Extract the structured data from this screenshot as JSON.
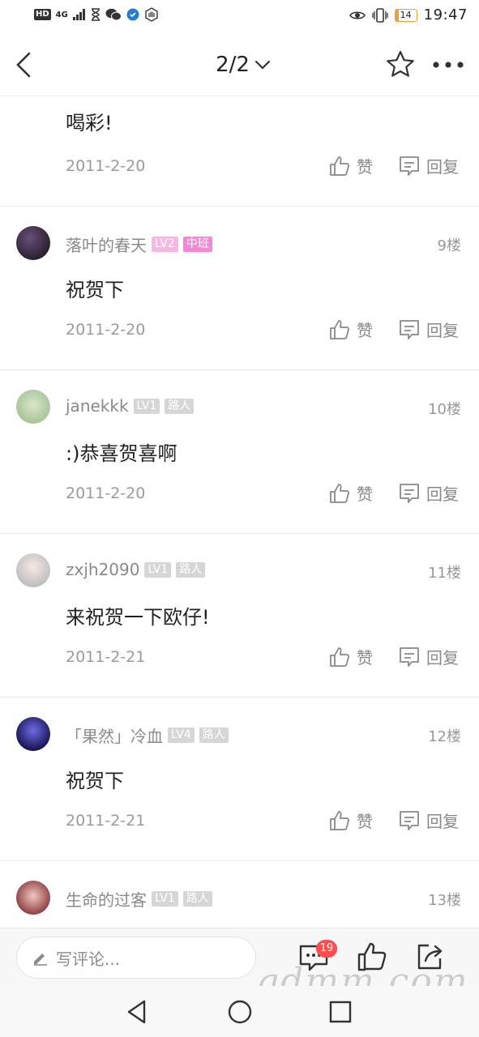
{
  "status_bar": {
    "hd": "HD",
    "network": "4G",
    "battery": "14",
    "time": "19:47"
  },
  "header": {
    "page_indicator": "2/2"
  },
  "posts": [
    {
      "text": "喝彩!",
      "date": "2011-2-20",
      "like_label": "赞",
      "reply_label": "回复"
    },
    {
      "username": "落叶的春天",
      "level": "LV2",
      "rank": "中班",
      "floor": "9楼",
      "text": "祝贺下",
      "date": "2011-2-20",
      "like_label": "赞",
      "reply_label": "回复"
    },
    {
      "username": "janekkk",
      "level": "LV1",
      "rank": "路人",
      "floor": "10楼",
      "text": ":)恭喜贺喜啊",
      "date": "2011-2-20",
      "like_label": "赞",
      "reply_label": "回复"
    },
    {
      "username": "zxjh2090",
      "level": "LV1",
      "rank": "路人",
      "floor": "11楼",
      "text": "来祝贺一下欧仔!",
      "date": "2011-2-21",
      "like_label": "赞",
      "reply_label": "回复"
    },
    {
      "username": "「果然」冷血",
      "level": "LV4",
      "rank": "路人",
      "floor": "12楼",
      "text": "祝贺下",
      "date": "2011-2-21",
      "like_label": "赞",
      "reply_label": "回复"
    },
    {
      "username": "生命的过客",
      "level": "LV1",
      "rank": "路人",
      "floor": "13楼"
    }
  ],
  "bottom_bar": {
    "comment_placeholder": "写评论...",
    "comment_count": "19"
  },
  "watermark": "gdmm.com",
  "colors": {
    "level_pink": "#f6b7e2",
    "rank_pink": "#f08ad3",
    "badge_gray": "#d6d6d6",
    "notification_red": "#ff4d4f"
  }
}
